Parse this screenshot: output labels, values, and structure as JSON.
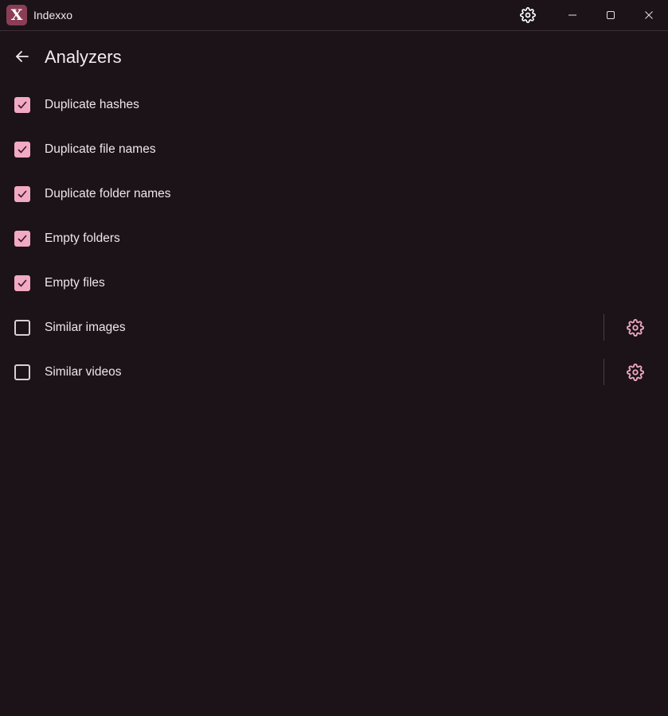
{
  "window": {
    "title": "Indexxo",
    "logo_letter": "X",
    "logo_color": "#8a3e56"
  },
  "page": {
    "title": "Analyzers"
  },
  "colors": {
    "background": "#1b1317",
    "accent": "#f2a9c2"
  },
  "analyzers": [
    {
      "label": "Duplicate hashes",
      "checked": true,
      "has_settings": false
    },
    {
      "label": "Duplicate file names",
      "checked": true,
      "has_settings": false
    },
    {
      "label": "Duplicate folder names",
      "checked": true,
      "has_settings": false
    },
    {
      "label": "Empty folders",
      "checked": true,
      "has_settings": false
    },
    {
      "label": "Empty files",
      "checked": true,
      "has_settings": false
    },
    {
      "label": "Similar images",
      "checked": false,
      "has_settings": true
    },
    {
      "label": "Similar videos",
      "checked": false,
      "has_settings": true
    }
  ],
  "icons": {
    "titlebar": [
      "gear-icon",
      "minimize-icon",
      "maximize-icon",
      "close-icon"
    ],
    "back": "arrow-left-icon",
    "row_settings": "gear-icon",
    "checkmark": "checkmark-icon"
  }
}
